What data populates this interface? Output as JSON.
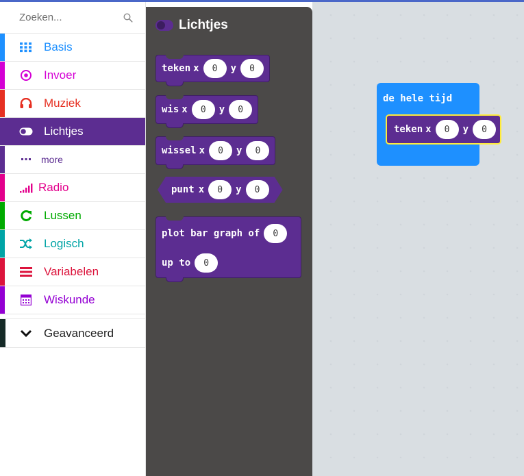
{
  "search": {
    "placeholder": "Zoeken..."
  },
  "categories": [
    {
      "label": "Basis",
      "color": "#1e90ff",
      "icon": "grid-icon"
    },
    {
      "label": "Invoer",
      "color": "#d400d4",
      "icon": "target-icon"
    },
    {
      "label": "Muziek",
      "color": "#e63022",
      "icon": "headphones-icon"
    },
    {
      "label": "Lichtjes",
      "color": "#5c2d91",
      "icon": "toggle-icon",
      "selected": true
    },
    {
      "label": "more",
      "color": "#5c2d91",
      "icon": "dots-icon"
    },
    {
      "label": "Radio",
      "color": "#e3008c",
      "icon": "signal-icon"
    },
    {
      "label": "Lussen",
      "color": "#00aa00",
      "icon": "refresh-icon"
    },
    {
      "label": "Logisch",
      "color": "#00a4a6",
      "icon": "shuffle-icon"
    },
    {
      "label": "Variabelen",
      "color": "#dc143c",
      "icon": "lines-icon"
    },
    {
      "label": "Wiskunde",
      "color": "#9400d3",
      "icon": "calculator-icon"
    },
    {
      "label": "Geavanceerd",
      "color": "#152a27",
      "icon": "chevron-down-icon"
    }
  ],
  "flyout": {
    "title": "Lichtjes",
    "blocks": {
      "plot": {
        "word": "teken",
        "x": "x",
        "y": "y",
        "xval": "0",
        "yval": "0"
      },
      "unplot": {
        "word": "wis",
        "x": "x",
        "y": "y",
        "xval": "0",
        "yval": "0"
      },
      "toggle": {
        "word": "wissel",
        "x": "x",
        "y": "y",
        "xval": "0",
        "yval": "0"
      },
      "point": {
        "word": "punt",
        "x": "x",
        "y": "y",
        "xval": "0",
        "yval": "0"
      },
      "bargraph": {
        "line1": "plot bar graph of",
        "val1": "0",
        "line2": "up to",
        "val2": "0"
      }
    }
  },
  "workspace": {
    "event_label": "de hele tijd",
    "block": {
      "word": "teken",
      "x": "x",
      "y": "y",
      "xval": "0",
      "yval": "0"
    }
  },
  "colors": {
    "lichtjes": "#5c2d91",
    "basis": "#1e90ff",
    "flyout_bg": "#4b4948",
    "workspace_bg": "#ecf0f2",
    "highlight": "#ffeb3b"
  }
}
